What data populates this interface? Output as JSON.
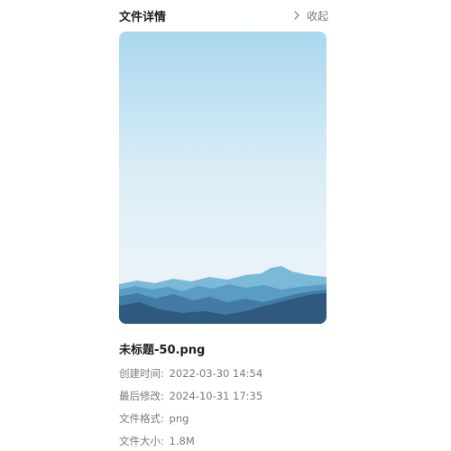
{
  "panel": {
    "title": "文件详情",
    "collapse_label": "收起"
  },
  "preview": {
    "description": "",
    "colors": {
      "sky_top": "#a9d8ee",
      "sky_mid": "#e3f1f8",
      "sky_bottom": "#ece9f4",
      "mountain_far": "#6aaed0",
      "mountain_mid": "#4f8fb8",
      "mountain_near": "#3a6f96",
      "mountain_front": "#2f5b80"
    }
  },
  "file": {
    "name": "未标题-50.png",
    "created_label": "创建时间:",
    "created_value": "2022-03-30 14:54",
    "modified_label": "最后修改:",
    "modified_value": "2024-10-31 17:35",
    "format_label": "文件格式:",
    "format_value": "png",
    "size_label": "文件大小:",
    "size_value": "1.8M"
  }
}
